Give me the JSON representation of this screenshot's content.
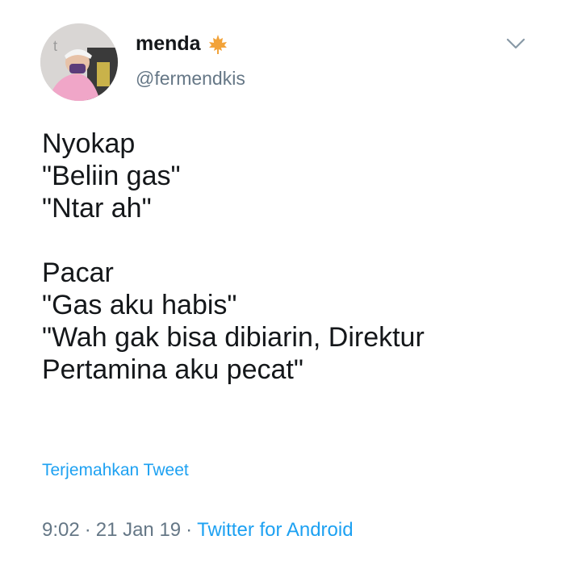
{
  "user": {
    "display_name": "menda",
    "badge_icon": "maple-leaf-icon",
    "handle": "@fermendkis",
    "avatar_watermark": "t"
  },
  "tweet": {
    "lines": [
      "Nyokap",
      "\"Beliin gas\"",
      "\"Ntar ah\"",
      "",
      "Pacar",
      "\"Gas aku habis\"",
      "\"Wah gak bisa dibiarin, Direktur",
      "Pertamina aku pecat\""
    ],
    "translate_label": "Terjemahkan Tweet",
    "time": "9:02",
    "date": "21 Jan 19",
    "source": "Twitter for Android",
    "separator": "·"
  },
  "colors": {
    "text": "#14171a",
    "secondary": "#657786",
    "link": "#1da1f2",
    "leaf": "#f2a33a"
  }
}
